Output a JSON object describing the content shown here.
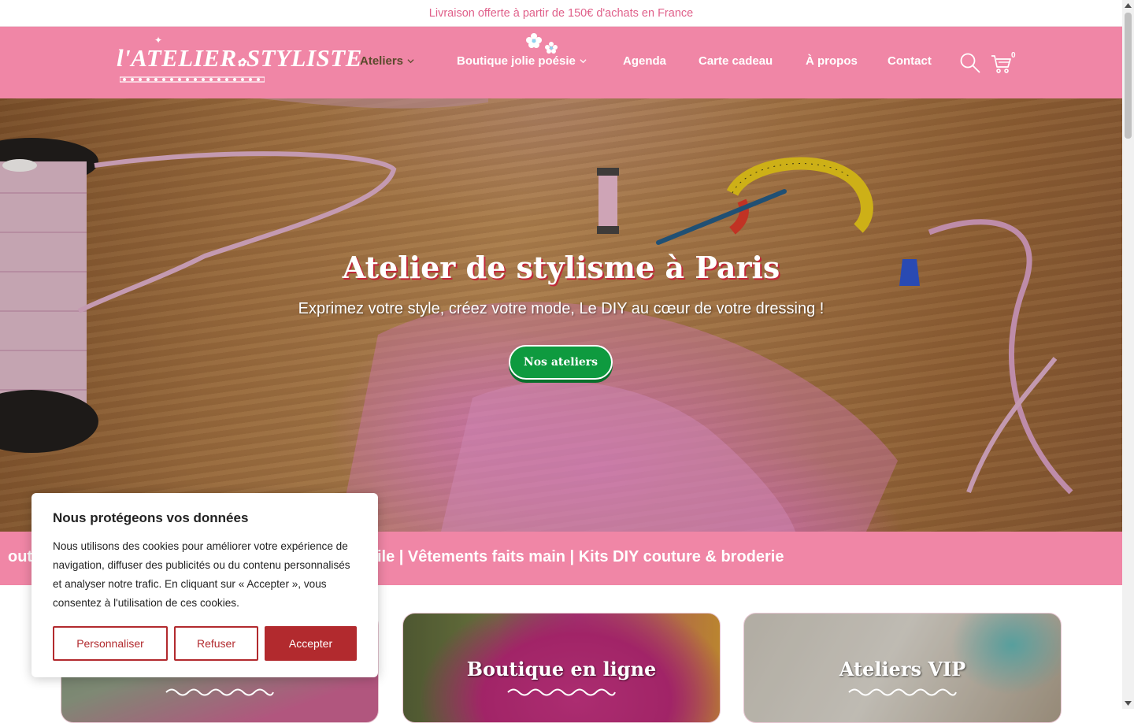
{
  "announcement": "Livraison offerte à partir de 150€ d'achats en France",
  "logo": {
    "alt": "L'Atelier du Styliste",
    "text": "ATELIER·STYLISTE"
  },
  "nav": {
    "items": [
      {
        "label": "Ateliers",
        "has_dropdown": true,
        "active": true
      },
      {
        "label": "Boutique jolie poésie",
        "has_dropdown": true,
        "active": false
      },
      {
        "label": "Agenda",
        "has_dropdown": false,
        "active": false
      },
      {
        "label": "Carte cadeau",
        "has_dropdown": false,
        "active": false
      },
      {
        "label": "À propos",
        "has_dropdown": false,
        "active": false
      },
      {
        "label": "Contact",
        "has_dropdown": false,
        "active": false
      }
    ],
    "search_icon": "search-icon",
    "cart_icon": "cart-icon",
    "cart_count": "0"
  },
  "hero": {
    "title": "Atelier de stylisme à Paris",
    "subtitle": "Exprimez votre style, créez votre mode, Le DIY au cœur de votre dressing !",
    "cta_label": "Nos ateliers"
  },
  "marquee": {
    "text": "out        stomisation | Upcycling & transformation textile | Vêtements faits main | Kits DIY couture & broderie"
  },
  "cards": [
    {
      "title": "",
      "subtitle": ""
    },
    {
      "title": "Boutique en ligne",
      "subtitle": ""
    },
    {
      "title": "Ateliers VIP",
      "subtitle": ""
    }
  ],
  "cookie": {
    "title": "Nous protégeons vos données",
    "text": "Nous utilisons des cookies pour améliorer votre expérience de navigation, diffuser des publicités ou du contenu personnalisés et analyser notre trafic. En cliquant sur « Accepter », vous consentez à l'utilisation de ces cookies.",
    "customize_label": "Personnaliser",
    "refuse_label": "Refuser",
    "accept_label": "Accepter"
  },
  "colors": {
    "brand_pink": "#f086a6",
    "announcement_text": "#e0608a",
    "cta_green": "#0e9a3f",
    "cookie_red": "#b22a2e",
    "nav_active": "#5a4a2c"
  }
}
